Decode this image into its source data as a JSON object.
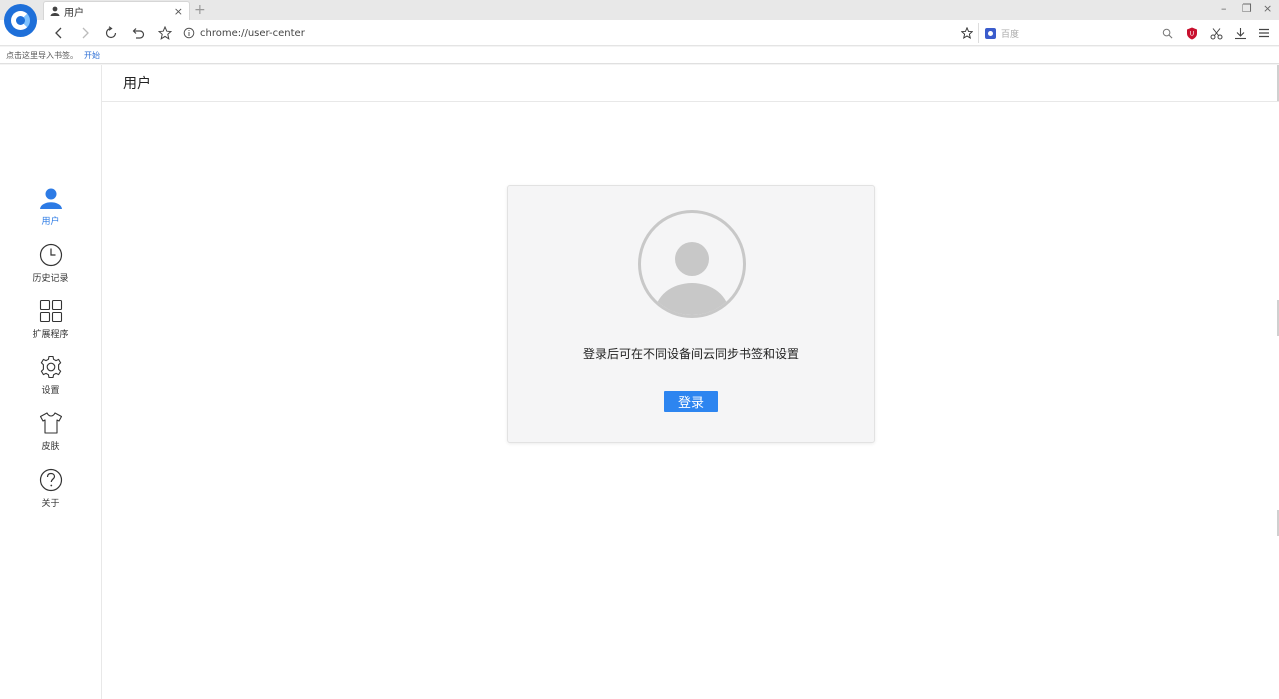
{
  "browser": {
    "tab": {
      "title": "用户",
      "close": "×"
    },
    "new_tab": "+",
    "window_controls": {
      "minimize": "–",
      "restore": "❐",
      "close": "×"
    },
    "address": {
      "url": "chrome://user-center"
    },
    "search": {
      "placeholder": "百度"
    },
    "bookmarks_bar": {
      "prompt": "点击这里导入书签。",
      "start_link": "开始"
    }
  },
  "sidebar": {
    "items": [
      {
        "label": "用户",
        "icon": "user-icon",
        "active": true
      },
      {
        "label": "历史记录",
        "icon": "clock-icon"
      },
      {
        "label": "扩展程序",
        "icon": "grid-icon"
      },
      {
        "label": "设置",
        "icon": "gear-icon"
      },
      {
        "label": "皮肤",
        "icon": "tshirt-icon"
      },
      {
        "label": "关于",
        "icon": "help-icon"
      }
    ]
  },
  "header": {
    "title": "用户"
  },
  "login_card": {
    "message": "登录后可在不同设备间云同步书签和设置",
    "button": "登录"
  },
  "colors": {
    "accent": "#2d85f0",
    "active_nav": "#2d7be5",
    "avatar_gray": "#c8c8c8",
    "brand_blue": "#1e6fd9"
  }
}
